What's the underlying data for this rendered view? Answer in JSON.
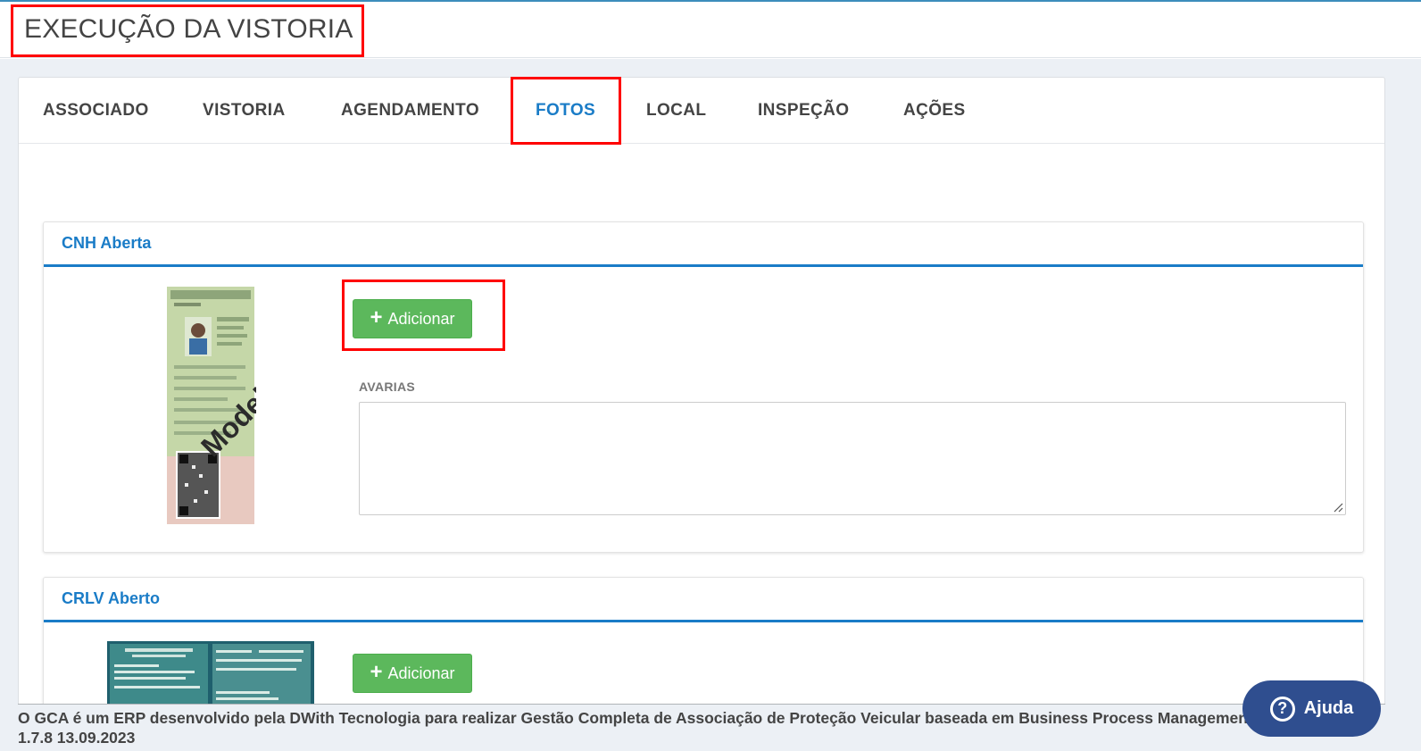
{
  "header": {
    "title": "EXECUÇÃO DA VISTORIA"
  },
  "tabs": [
    {
      "label": "ASSOCIADO"
    },
    {
      "label": "VISTORIA"
    },
    {
      "label": "AGENDAMENTO"
    },
    {
      "label": "FOTOS"
    },
    {
      "label": "LOCAL"
    },
    {
      "label": "INSPEÇÃO"
    },
    {
      "label": "AÇÕES"
    }
  ],
  "active_tab": "FOTOS",
  "sections": [
    {
      "title": "CNH Aberta",
      "add_label": "Adicionar",
      "field_label": "AVARIAS",
      "field_value": "",
      "image_watermark": "Modelo"
    },
    {
      "title": "CRLV Aberto",
      "add_label": "Adicionar"
    }
  ],
  "footer": {
    "text": "O GCA é um ERP desenvolvido pela DWith Tecnologia para realizar Gestão Completa de Associação de Proteção Veicular baseada em Business Process Management (BPM)",
    "version": "1.7.8 13.09.2023"
  },
  "help": {
    "label": "Ajuda"
  },
  "colors": {
    "accent_blue": "#1a7cc7",
    "success_green": "#5cb85c",
    "help_navy": "#2f4e8f",
    "highlight_red": "#ff0000"
  }
}
